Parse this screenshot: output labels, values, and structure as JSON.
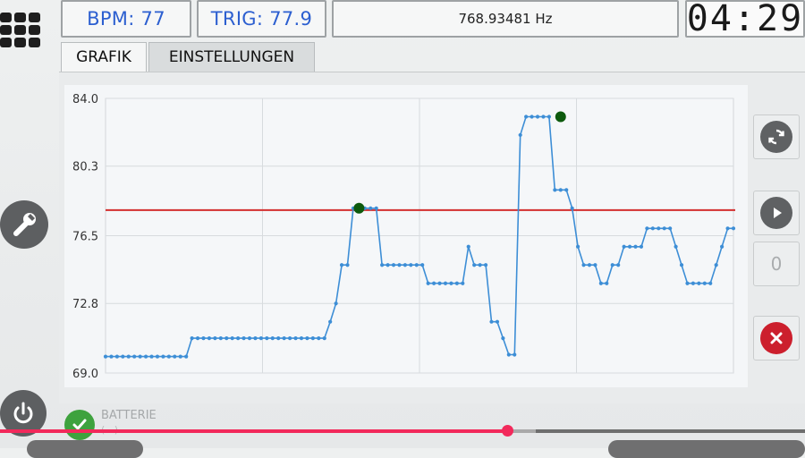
{
  "header": {
    "bpm": "BPM: 77",
    "trig": "TRIG: 77.9",
    "frequency": "768.93481 Hz",
    "clock": "04:29"
  },
  "tabs": [
    {
      "label": "GRAFIK",
      "active": true
    },
    {
      "label": "EINSTELLUNGEN",
      "active": false
    }
  ],
  "side_buttons": {
    "counter_value": "0"
  },
  "status": {
    "battery_label": "BATTERIE",
    "battery_value": "(...)"
  },
  "progress": {
    "played_fraction": 0.63,
    "buffered_fraction": 0.665
  },
  "icons": [
    "menu-grid-icon",
    "wrench-icon",
    "power-icon",
    "refresh-icon",
    "play-icon",
    "close-icon",
    "check-icon"
  ],
  "colors": {
    "accent_blue": "#2c5fd0",
    "series": "#3d8ed6",
    "trigger_line": "#d32f2f",
    "marker": "#0d5a0d",
    "close_red": "#cc1f2d",
    "check_green": "#3ea23e",
    "progress": "#f2295b"
  },
  "chart_data": {
    "type": "line",
    "ytick_labels": [
      "84.0",
      "80.3",
      "76.5",
      "72.8",
      "69.0"
    ],
    "yticks": [
      84.0,
      80.3,
      76.5,
      72.8,
      69.0
    ],
    "ylim": [
      69.0,
      84.0
    ],
    "grid": true,
    "trigger_level": 77.9,
    "series": [
      {
        "values": [
          69.9,
          69.9,
          69.9,
          69.9,
          69.9,
          69.9,
          69.9,
          69.9,
          69.9,
          69.9,
          69.9,
          69.9,
          69.9,
          69.9,
          69.9,
          70.9,
          70.9,
          70.9,
          70.9,
          70.9,
          70.9,
          70.9,
          70.9,
          70.9,
          70.9,
          70.9,
          70.9,
          70.9,
          70.9,
          70.9,
          70.9,
          70.9,
          70.9,
          70.9,
          70.9,
          70.9,
          70.9,
          70.9,
          70.9,
          71.8,
          72.8,
          74.9,
          74.9,
          78.0,
          78.0,
          78.0,
          78.0,
          78.0,
          74.9,
          74.9,
          74.9,
          74.9,
          74.9,
          74.9,
          74.9,
          74.9,
          73.9,
          73.9,
          73.9,
          73.9,
          73.9,
          73.9,
          73.9,
          75.9,
          74.9,
          74.9,
          74.9,
          71.8,
          71.8,
          70.9,
          70.0,
          70.0,
          82.0,
          83.0,
          83.0,
          83.0,
          83.0,
          83.0,
          79.0,
          79.0,
          79.0,
          78.0,
          75.9,
          74.9,
          74.9,
          74.9,
          73.9,
          73.9,
          74.9,
          74.9,
          75.9,
          75.9,
          75.9,
          75.9,
          76.9,
          76.9,
          76.9,
          76.9,
          76.9,
          75.9,
          74.9,
          73.9,
          73.9,
          73.9,
          73.9,
          73.9,
          74.9,
          75.9,
          76.9,
          76.9
        ],
        "markers": [
          {
            "index": 44,
            "value": 78.0
          },
          {
            "index": 79,
            "value": 83.0
          }
        ]
      }
    ]
  }
}
